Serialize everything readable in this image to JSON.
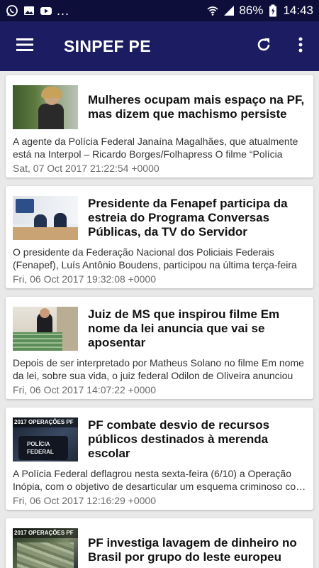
{
  "status_bar": {
    "battery": "86%",
    "time": "14:43",
    "more": "..."
  },
  "app_bar": {
    "title": "SINPEF PE",
    "menu_icon": "hamburger-menu-icon",
    "refresh_icon": "refresh-icon",
    "overflow_icon": "more-vert-icon"
  },
  "colors": {
    "status_bar": "#0d0e3a",
    "app_bar": "#1c1c62",
    "background": "#e9e9e9",
    "card": "#ffffff"
  },
  "articles": [
    {
      "title": "Mulheres ocupam mais espaço na PF, mas dizem que machismo persiste",
      "summary": "A agente da Polícia Federal Janaína Magalhães, que atualmente está na Interpol – Ricardo Borges/Folhapress  O filme “Polícia Fe…",
      "date": "Sat, 07 Oct 2017 21:22:54 +0000"
    },
    {
      "title": "Presidente da Fenapef participa da estreia do Programa Conversas Públicas, da TV do Servidor",
      "summary": "O presidente da Federação Nacional dos Policiais Federais (Fenapef), Luís Antônio Boudens, participou na última terça-feira …",
      "date": "Fri, 06 Oct 2017 19:32:08 +0000"
    },
    {
      "title": "Juiz de MS que inspirou filme Em nome da lei anuncia que vai se aposentar",
      "summary": "Depois de ser interpretado por Matheus Solano no filme Em nome da lei, sobre sua vida, o juiz federal Odilon de Oliveira anunciou q…",
      "date": "Fri, 06 Oct 2017 14:07:22 +0000"
    },
    {
      "title": "PF combate desvio de recursos públicos destinados à merenda escolar",
      "summary": "A Polícia Federal deflagrou nesta sexta-feira (6/10) a Operação Inópia, com o objetivo de desarticular um esquema criminoso co…",
      "date": "Fri, 06 Oct 2017 12:16:29 +0000",
      "thumb_tag": "OPERAÇÕES PF",
      "thumb_year": "2017",
      "thumb_text": "POLÍCIA FEDERAL"
    },
    {
      "title": "PF investiga lavagem de dinheiro no Brasil por grupo do leste europeu",
      "thumb_tag": "OPERAÇÕES PF",
      "thumb_year": "2017"
    }
  ]
}
